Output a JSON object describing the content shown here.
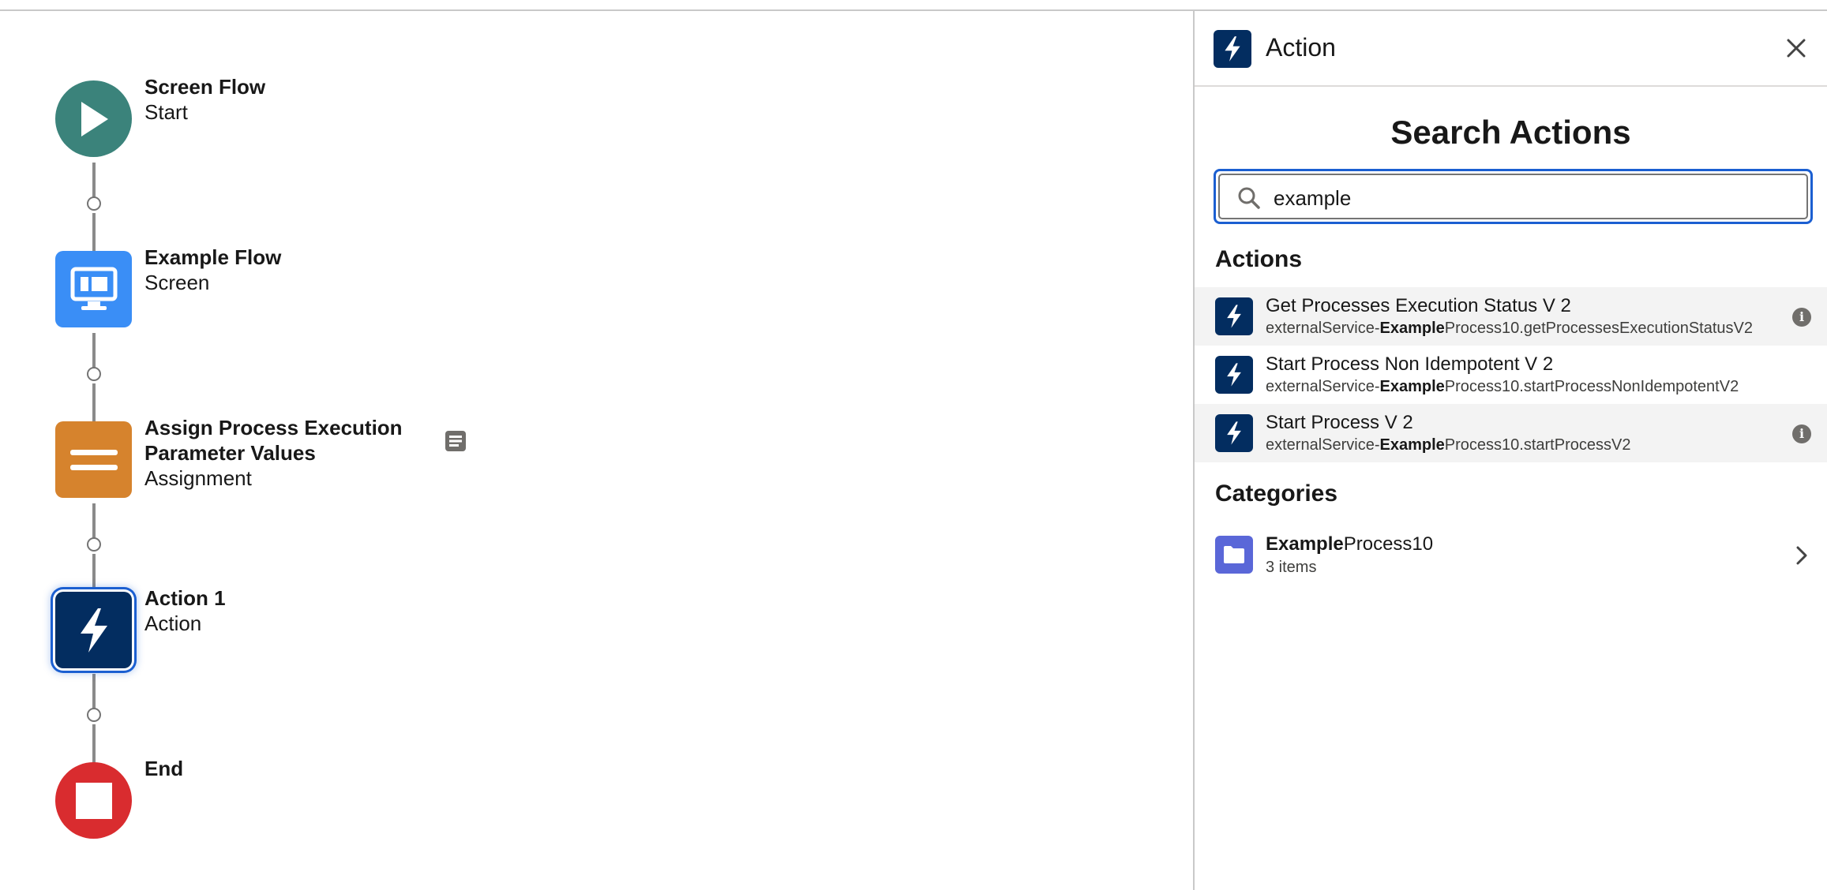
{
  "canvas": {
    "nodes": [
      {
        "title": "Screen Flow",
        "type": "Start",
        "icon": "play-icon",
        "color": "#3b837b"
      },
      {
        "title": "Example Flow",
        "type": "Screen",
        "icon": "screen-icon",
        "color": "#3a8ef6"
      },
      {
        "title": "Assign Process Execution Parameter Values",
        "type": "Assignment",
        "icon": "assignment-icon",
        "color": "#d6832d"
      },
      {
        "title": "Action 1",
        "type": "Action",
        "icon": "lightning-icon",
        "color": "#032d60"
      },
      {
        "title": "End",
        "type": "",
        "icon": "stop-icon",
        "color": "#d92c2f"
      }
    ]
  },
  "panel": {
    "title": "Action",
    "search_heading": "Search Actions",
    "search_value": "example",
    "actions_heading": "Actions",
    "actions": [
      {
        "name": "Get Processes Execution Status V 2",
        "sub_prefix": "externalService-",
        "sub_match": "Example",
        "sub_rest": "Process10.getProcessesExecutionStatusV2"
      },
      {
        "name": "Start Process Non Idempotent V 2",
        "sub_prefix": "externalService-",
        "sub_match": "Example",
        "sub_rest": "Process10.startProcessNonIdempotentV2"
      },
      {
        "name": "Start Process V 2",
        "sub_prefix": "externalService-",
        "sub_match": "Example",
        "sub_rest": "Process10.startProcessV2"
      }
    ],
    "categories_heading": "Categories",
    "category": {
      "name_match": "Example",
      "name_rest": "Process10",
      "count": "3 items"
    }
  },
  "colors": {
    "accent": "#1b5fd1",
    "action_navy": "#032d60",
    "category_purple": "#5a67d8"
  }
}
